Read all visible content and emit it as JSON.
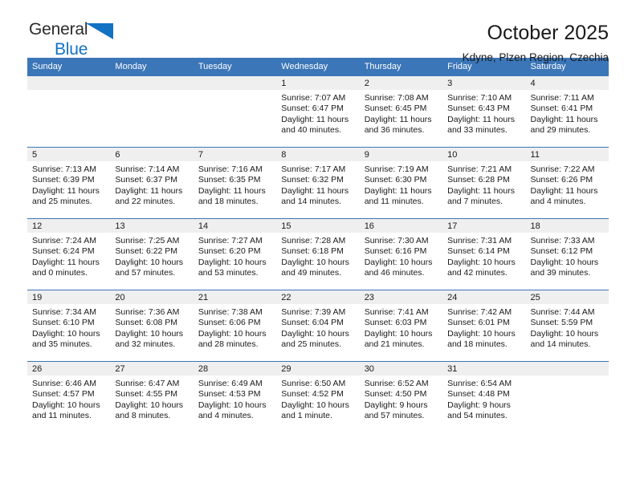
{
  "brand": {
    "name_part1": "General",
    "name_part2": "Blue",
    "triangle_icon": "triangle-icon",
    "color_dark": "#2b2b2b",
    "color_blue": "#1271c3"
  },
  "header": {
    "title": "October 2025",
    "subtitle": "Kdyne, Plzen Region, Czechia"
  },
  "theme": {
    "header_blue": "#3b76b8",
    "band_gray": "#efefef",
    "text": "#1a1a1a"
  },
  "weekdays": [
    "Sunday",
    "Monday",
    "Tuesday",
    "Wednesday",
    "Thursday",
    "Friday",
    "Saturday"
  ],
  "weeks": [
    [
      {
        "day": "",
        "sunrise": "",
        "sunset": "",
        "daylight": ""
      },
      {
        "day": "",
        "sunrise": "",
        "sunset": "",
        "daylight": ""
      },
      {
        "day": "",
        "sunrise": "",
        "sunset": "",
        "daylight": ""
      },
      {
        "day": "1",
        "sunrise": "Sunrise: 7:07 AM",
        "sunset": "Sunset: 6:47 PM",
        "daylight": "Daylight: 11 hours and 40 minutes."
      },
      {
        "day": "2",
        "sunrise": "Sunrise: 7:08 AM",
        "sunset": "Sunset: 6:45 PM",
        "daylight": "Daylight: 11 hours and 36 minutes."
      },
      {
        "day": "3",
        "sunrise": "Sunrise: 7:10 AM",
        "sunset": "Sunset: 6:43 PM",
        "daylight": "Daylight: 11 hours and 33 minutes."
      },
      {
        "day": "4",
        "sunrise": "Sunrise: 7:11 AM",
        "sunset": "Sunset: 6:41 PM",
        "daylight": "Daylight: 11 hours and 29 minutes."
      }
    ],
    [
      {
        "day": "5",
        "sunrise": "Sunrise: 7:13 AM",
        "sunset": "Sunset: 6:39 PM",
        "daylight": "Daylight: 11 hours and 25 minutes."
      },
      {
        "day": "6",
        "sunrise": "Sunrise: 7:14 AM",
        "sunset": "Sunset: 6:37 PM",
        "daylight": "Daylight: 11 hours and 22 minutes."
      },
      {
        "day": "7",
        "sunrise": "Sunrise: 7:16 AM",
        "sunset": "Sunset: 6:35 PM",
        "daylight": "Daylight: 11 hours and 18 minutes."
      },
      {
        "day": "8",
        "sunrise": "Sunrise: 7:17 AM",
        "sunset": "Sunset: 6:32 PM",
        "daylight": "Daylight: 11 hours and 14 minutes."
      },
      {
        "day": "9",
        "sunrise": "Sunrise: 7:19 AM",
        "sunset": "Sunset: 6:30 PM",
        "daylight": "Daylight: 11 hours and 11 minutes."
      },
      {
        "day": "10",
        "sunrise": "Sunrise: 7:21 AM",
        "sunset": "Sunset: 6:28 PM",
        "daylight": "Daylight: 11 hours and 7 minutes."
      },
      {
        "day": "11",
        "sunrise": "Sunrise: 7:22 AM",
        "sunset": "Sunset: 6:26 PM",
        "daylight": "Daylight: 11 hours and 4 minutes."
      }
    ],
    [
      {
        "day": "12",
        "sunrise": "Sunrise: 7:24 AM",
        "sunset": "Sunset: 6:24 PM",
        "daylight": "Daylight: 11 hours and 0 minutes."
      },
      {
        "day": "13",
        "sunrise": "Sunrise: 7:25 AM",
        "sunset": "Sunset: 6:22 PM",
        "daylight": "Daylight: 10 hours and 57 minutes."
      },
      {
        "day": "14",
        "sunrise": "Sunrise: 7:27 AM",
        "sunset": "Sunset: 6:20 PM",
        "daylight": "Daylight: 10 hours and 53 minutes."
      },
      {
        "day": "15",
        "sunrise": "Sunrise: 7:28 AM",
        "sunset": "Sunset: 6:18 PM",
        "daylight": "Daylight: 10 hours and 49 minutes."
      },
      {
        "day": "16",
        "sunrise": "Sunrise: 7:30 AM",
        "sunset": "Sunset: 6:16 PM",
        "daylight": "Daylight: 10 hours and 46 minutes."
      },
      {
        "day": "17",
        "sunrise": "Sunrise: 7:31 AM",
        "sunset": "Sunset: 6:14 PM",
        "daylight": "Daylight: 10 hours and 42 minutes."
      },
      {
        "day": "18",
        "sunrise": "Sunrise: 7:33 AM",
        "sunset": "Sunset: 6:12 PM",
        "daylight": "Daylight: 10 hours and 39 minutes."
      }
    ],
    [
      {
        "day": "19",
        "sunrise": "Sunrise: 7:34 AM",
        "sunset": "Sunset: 6:10 PM",
        "daylight": "Daylight: 10 hours and 35 minutes."
      },
      {
        "day": "20",
        "sunrise": "Sunrise: 7:36 AM",
        "sunset": "Sunset: 6:08 PM",
        "daylight": "Daylight: 10 hours and 32 minutes."
      },
      {
        "day": "21",
        "sunrise": "Sunrise: 7:38 AM",
        "sunset": "Sunset: 6:06 PM",
        "daylight": "Daylight: 10 hours and 28 minutes."
      },
      {
        "day": "22",
        "sunrise": "Sunrise: 7:39 AM",
        "sunset": "Sunset: 6:04 PM",
        "daylight": "Daylight: 10 hours and 25 minutes."
      },
      {
        "day": "23",
        "sunrise": "Sunrise: 7:41 AM",
        "sunset": "Sunset: 6:03 PM",
        "daylight": "Daylight: 10 hours and 21 minutes."
      },
      {
        "day": "24",
        "sunrise": "Sunrise: 7:42 AM",
        "sunset": "Sunset: 6:01 PM",
        "daylight": "Daylight: 10 hours and 18 minutes."
      },
      {
        "day": "25",
        "sunrise": "Sunrise: 7:44 AM",
        "sunset": "Sunset: 5:59 PM",
        "daylight": "Daylight: 10 hours and 14 minutes."
      }
    ],
    [
      {
        "day": "26",
        "sunrise": "Sunrise: 6:46 AM",
        "sunset": "Sunset: 4:57 PM",
        "daylight": "Daylight: 10 hours and 11 minutes."
      },
      {
        "day": "27",
        "sunrise": "Sunrise: 6:47 AM",
        "sunset": "Sunset: 4:55 PM",
        "daylight": "Daylight: 10 hours and 8 minutes."
      },
      {
        "day": "28",
        "sunrise": "Sunrise: 6:49 AM",
        "sunset": "Sunset: 4:53 PM",
        "daylight": "Daylight: 10 hours and 4 minutes."
      },
      {
        "day": "29",
        "sunrise": "Sunrise: 6:50 AM",
        "sunset": "Sunset: 4:52 PM",
        "daylight": "Daylight: 10 hours and 1 minute."
      },
      {
        "day": "30",
        "sunrise": "Sunrise: 6:52 AM",
        "sunset": "Sunset: 4:50 PM",
        "daylight": "Daylight: 9 hours and 57 minutes."
      },
      {
        "day": "31",
        "sunrise": "Sunrise: 6:54 AM",
        "sunset": "Sunset: 4:48 PM",
        "daylight": "Daylight: 9 hours and 54 minutes."
      },
      {
        "day": "",
        "sunrise": "",
        "sunset": "",
        "daylight": ""
      }
    ]
  ]
}
